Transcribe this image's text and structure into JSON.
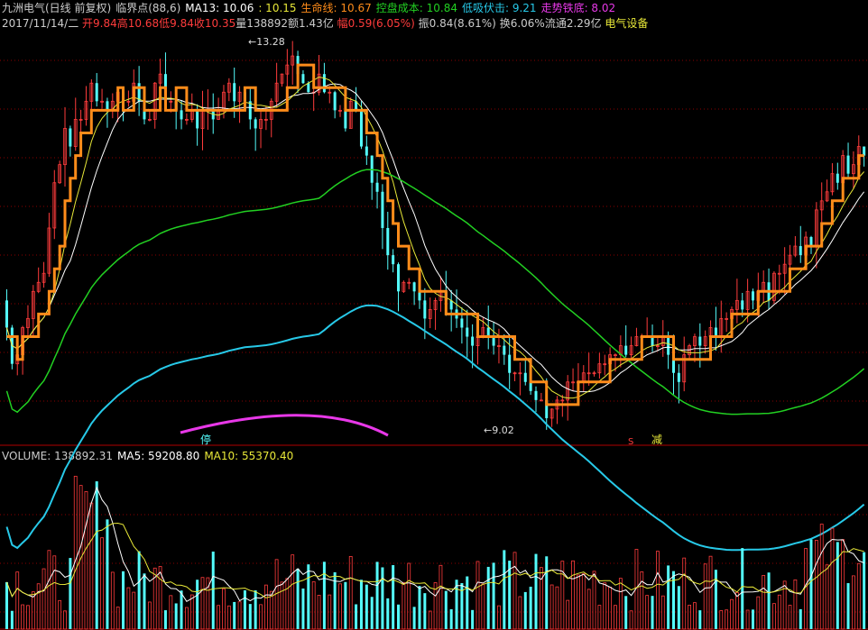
{
  "header": {
    "stock_name": "九洲电气(日线 前复权)",
    "indicator": "临界点(88,6)",
    "ma13": "MA13: 10.06",
    "ma13_val2": ": 10.15",
    "life_line": "生命线: 10.67",
    "control_cost": "控盘成本: 10.84",
    "low_absorb": "低吸伏击: 9.21",
    "trend_bottom": "走势铁底: 8.02"
  },
  "quote": {
    "date": "2017/11/14/二",
    "open": "开9.84",
    "high": "高10.68",
    "low": "低9.84",
    "close": "收10.35",
    "volume": "量138892",
    "amount": "额1.43亿",
    "change": "幅0.59(6.05%)",
    "amplitude": "振0.84(8.61%)",
    "turnover": "换6.06%",
    "float": "流通2.29亿",
    "sector": "电气设备"
  },
  "price_annotations": {
    "high_label": "13.28",
    "low_label": "9.02"
  },
  "signals": {
    "stop": "停",
    "sell": "S",
    "reduce": "减"
  },
  "volume_header": {
    "volume": "VOLUME: 138892.31",
    "ma5": "MA5: 59208.80",
    "ma10": "MA10: 55370.40"
  },
  "colors": {
    "up": "#ff3c3c",
    "down": "#54fcfc",
    "orange": "#ff8c1a",
    "green": "#22d022",
    "cyan": "#27c9e8",
    "magenta": "#e838e8",
    "white": "#ffffff",
    "yellow": "#e8e838",
    "grid": "#8a0000"
  },
  "chart_data": {
    "type": "candlestick",
    "candles": [
      [
        10.4,
        10.1
      ],
      [
        10.1,
        9.7
      ],
      [
        9.7,
        9.8
      ],
      [
        9.8,
        10.1
      ],
      [
        10.1,
        10.2
      ],
      [
        10.2,
        10.5
      ],
      [
        10.5,
        10.6
      ],
      [
        10.6,
        10.7
      ],
      [
        10.7,
        11.2
      ],
      [
        11.2,
        11.7
      ],
      [
        11.7,
        11.9
      ],
      [
        11.9,
        12.3
      ],
      [
        12.3,
        12.1
      ],
      [
        12.1,
        12.4
      ],
      [
        12.4,
        12.4
      ],
      [
        12.4,
        12.6
      ],
      [
        12.6,
        12.8
      ],
      [
        12.8,
        12.6
      ],
      [
        12.6,
        12.6
      ],
      [
        12.6,
        12.5
      ],
      [
        12.5,
        12.6
      ],
      [
        12.6,
        12.7
      ],
      [
        12.7,
        12.6
      ],
      [
        12.6,
        12.6
      ],
      [
        12.6,
        12.8
      ],
      [
        12.8,
        12.6
      ],
      [
        12.6,
        12.4
      ],
      [
        12.4,
        12.4
      ],
      [
        12.4,
        12.8
      ],
      [
        12.8,
        12.9
      ],
      [
        12.9,
        12.6
      ],
      [
        12.6,
        12.6
      ],
      [
        12.6,
        12.5
      ],
      [
        12.5,
        12.4
      ],
      [
        12.4,
        12.4
      ],
      [
        12.4,
        12.5
      ],
      [
        12.5,
        12.3
      ],
      [
        12.3,
        12.5
      ],
      [
        12.5,
        12.5
      ],
      [
        12.5,
        12.4
      ],
      [
        12.4,
        12.5
      ],
      [
        12.5,
        12.7
      ],
      [
        12.7,
        12.8
      ],
      [
        12.8,
        12.6
      ],
      [
        12.6,
        12.7
      ],
      [
        12.7,
        12.6
      ],
      [
        12.6,
        12.4
      ],
      [
        12.4,
        12.3
      ],
      [
        12.3,
        12.4
      ],
      [
        12.4,
        12.4
      ],
      [
        12.4,
        12.6
      ],
      [
        12.6,
        12.8
      ],
      [
        12.8,
        12.9
      ],
      [
        12.9,
        13.0
      ],
      [
        13.0,
        13.1
      ],
      [
        13.1,
        12.9
      ],
      [
        12.9,
        12.8
      ],
      [
        12.8,
        12.7
      ],
      [
        12.7,
        12.7
      ],
      [
        12.7,
        12.9
      ],
      [
        12.9,
        12.7
      ],
      [
        12.7,
        12.7
      ],
      [
        12.7,
        12.5
      ],
      [
        12.5,
        12.5
      ],
      [
        12.5,
        12.3
      ],
      [
        12.3,
        12.6
      ],
      [
        12.6,
        12.5
      ],
      [
        12.5,
        12.1
      ],
      [
        12.1,
        12.0
      ],
      [
        12.0,
        11.7
      ],
      [
        11.7,
        11.6
      ],
      [
        11.6,
        11.2
      ],
      [
        11.2,
        10.9
      ],
      [
        10.9,
        10.8
      ],
      [
        10.8,
        10.5
      ],
      [
        10.5,
        10.6
      ],
      [
        10.6,
        10.6
      ],
      [
        10.6,
        10.5
      ],
      [
        10.5,
        10.4
      ],
      [
        10.4,
        10.2
      ],
      [
        10.2,
        10.3
      ],
      [
        10.3,
        10.4
      ],
      [
        10.4,
        10.5
      ],
      [
        10.5,
        10.4
      ],
      [
        10.4,
        10.3
      ],
      [
        10.3,
        10.2
      ],
      [
        10.2,
        10.1
      ],
      [
        10.1,
        10.0
      ],
      [
        10.0,
        9.9
      ],
      [
        9.9,
        10.0
      ],
      [
        10.0,
        10.1
      ],
      [
        10.1,
        10.0
      ],
      [
        10.0,
        9.9
      ],
      [
        9.9,
        9.9
      ],
      [
        9.9,
        9.8
      ],
      [
        9.8,
        9.6
      ],
      [
        9.6,
        9.6
      ],
      [
        9.6,
        9.6
      ],
      [
        9.6,
        9.5
      ],
      [
        9.5,
        9.4
      ],
      [
        9.4,
        9.3
      ],
      [
        9.3,
        9.3
      ],
      [
        9.3,
        9.1
      ],
      [
        9.1,
        9.2
      ],
      [
        9.2,
        9.3
      ],
      [
        9.3,
        9.3
      ],
      [
        9.3,
        9.5
      ],
      [
        9.5,
        9.5
      ],
      [
        9.5,
        9.5
      ],
      [
        9.5,
        9.6
      ],
      [
        9.6,
        9.6
      ],
      [
        9.6,
        9.6
      ],
      [
        9.6,
        9.7
      ],
      [
        9.7,
        9.7
      ],
      [
        9.7,
        9.8
      ],
      [
        9.8,
        9.8
      ],
      [
        9.8,
        9.9
      ],
      [
        9.9,
        9.8
      ],
      [
        9.8,
        9.9
      ],
      [
        9.9,
        10.0
      ],
      [
        10.0,
        10.0
      ],
      [
        10.0,
        10.0
      ],
      [
        10.0,
        9.9
      ],
      [
        9.9,
        9.9
      ],
      [
        9.9,
        10.0
      ],
      [
        10.0,
        9.8
      ],
      [
        9.8,
        9.6
      ],
      [
        9.6,
        9.5
      ],
      [
        9.5,
        9.8
      ],
      [
        9.8,
        9.9
      ],
      [
        9.9,
        10.0
      ],
      [
        10.0,
        9.9
      ],
      [
        9.9,
        10.0
      ],
      [
        10.0,
        10.1
      ],
      [
        10.1,
        10.0
      ],
      [
        10.0,
        10.2
      ],
      [
        10.2,
        10.2
      ],
      [
        10.2,
        10.3
      ],
      [
        10.3,
        10.4
      ],
      [
        10.4,
        10.3
      ],
      [
        10.3,
        10.5
      ],
      [
        10.5,
        10.4
      ],
      [
        10.4,
        10.5
      ],
      [
        10.5,
        10.6
      ],
      [
        10.6,
        10.4
      ],
      [
        10.4,
        10.7
      ],
      [
        10.7,
        10.7
      ],
      [
        10.7,
        10.8
      ],
      [
        10.8,
        10.9
      ],
      [
        10.9,
        11.0
      ],
      [
        11.0,
        10.9
      ],
      [
        10.9,
        11.1
      ],
      [
        11.1,
        11.0
      ],
      [
        11.0,
        11.4
      ],
      [
        11.4,
        11.5
      ],
      [
        11.5,
        11.6
      ],
      [
        11.6,
        11.8
      ],
      [
        11.8,
        11.7
      ],
      [
        11.7,
        12.0
      ],
      [
        12.0,
        11.8
      ],
      [
        11.8,
        11.9
      ],
      [
        11.9,
        12.1
      ],
      [
        12.1,
        12.0
      ]
    ],
    "xlabel": "",
    "ylabel": ""
  }
}
